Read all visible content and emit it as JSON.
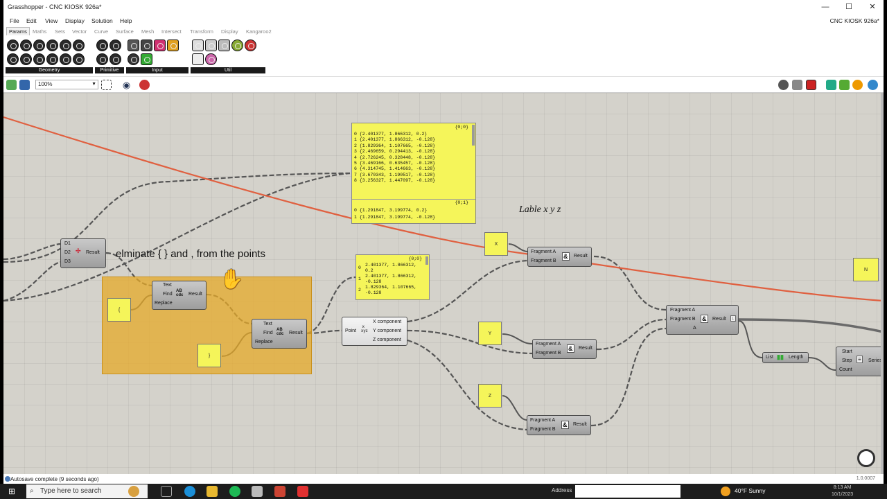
{
  "window": {
    "title": "Grasshopper - CNC KIOSK 926a*",
    "document": "CNC KIOSK 926a*",
    "minimize": "—",
    "maximize": "☐",
    "close": "✕"
  },
  "menu": [
    "File",
    "Edit",
    "View",
    "Display",
    "Solution",
    "Help"
  ],
  "tabs": [
    "Params",
    "Maths",
    "Sets",
    "Vector",
    "Curve",
    "Surface",
    "Mesh",
    "Intersect",
    "Transform",
    "Display",
    "Kangaroo2"
  ],
  "active_tab": "Params",
  "ribbon_groups": [
    "Geometry",
    "Primitive",
    "Input",
    "Util"
  ],
  "toolbar": {
    "zoom": "100%"
  },
  "annotations": {
    "eliminate": "elminate {   } and , from the points",
    "label_xyz": "Lable x y z"
  },
  "panel_points": {
    "header0": "{0;0}",
    "rows0": [
      "0 {2.401377, 1.866312, 0.2}",
      "1 {2.401377, 1.866312, -0.128}",
      "2 {1.829364, 1.107665, -0.128}",
      "3 {2.469659, 0.294413, -0.128}",
      "4 {2.726245, 0.328448, -0.128}",
      "5 {3.469166, 0.635457, -0.128}",
      "6 {4.314745, 1.414663, -0.128}",
      "7 {3.670343, 1.190517, -0.128}",
      "8 {3.256327, 1.447097, -0.128}"
    ],
    "header1": "{0;1}",
    "rows1": [
      "0 {1.291847, 3.199774, 0.2}",
      "1 {1.291847, 3.199774, -0.128}"
    ]
  },
  "panel_clean": {
    "header": "{0;0}",
    "rows": [
      [
        "0",
        "2.401377, 1.866312,",
        "0.2"
      ],
      [
        "1",
        "2.401377, 1.866312,",
        "-0.128"
      ],
      [
        "2",
        "1.829364, 1.107665,",
        "-0.128"
      ]
    ]
  },
  "nodes": {
    "d_merge": {
      "inputs": [
        "D1",
        "D2",
        "D3"
      ],
      "output": "Result"
    },
    "replace1": {
      "inputs": [
        "Text",
        "Find",
        "Replace"
      ],
      "output": "Result"
    },
    "replace2": {
      "inputs": [
        "Text",
        "Find",
        "Replace"
      ],
      "output": "Result"
    },
    "deconstruct": {
      "input": "Point",
      "outputs": [
        "X component",
        "Y component",
        "Z component"
      ]
    },
    "concat_x": {
      "inputs": [
        "Fragment A",
        "Fragment B"
      ],
      "output": "Result"
    },
    "concat_y": {
      "inputs": [
        "Fragment A",
        "Fragment B"
      ],
      "output": "Result"
    },
    "concat_z": {
      "inputs": [
        "Fragment A",
        "Fragment B"
      ],
      "output": "Result"
    },
    "concat_all": {
      "inputs": [
        "Fragment A",
        "Fragment B",
        "A"
      ],
      "output": "Result"
    },
    "list_length": {
      "input": "List",
      "output": "Length"
    },
    "series": {
      "inputs": [
        "Start",
        "Step",
        "Count"
      ],
      "output": "Series"
    }
  },
  "yellow_params": {
    "open_brace": "{",
    "close_brace": "}",
    "x": "X",
    "y": "Y",
    "z": "Z",
    "n": "N"
  },
  "status": {
    "text": "Autosave complete (9 seconds ago)",
    "version": "1.0.0007"
  },
  "taskbar": {
    "search_placeholder": "Type here to search",
    "address_label": "Address",
    "weather": "40°F  Sunny",
    "time": "8:13 AM",
    "date": "10/1/2023"
  }
}
